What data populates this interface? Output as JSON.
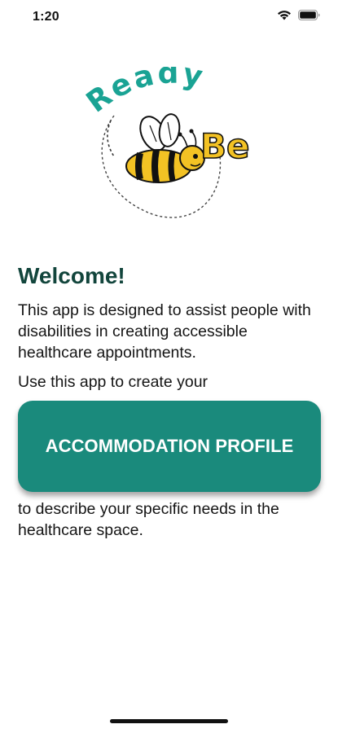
{
  "status_bar": {
    "time": "1:20",
    "icons": [
      "wifi-icon",
      "battery-icon"
    ]
  },
  "logo": {
    "word_top": "Ready",
    "word_right": "Be",
    "image": "bee-illustration",
    "colors": {
      "ready": "#1aa394",
      "be": "#f3c224",
      "bee_body": "#f3c224",
      "bee_stripes": "#111111"
    }
  },
  "welcome": {
    "title": "Welcome!",
    "description": "This app is designed to assist people with disabilities in creating accessible healthcare appointments.",
    "lead_in": "Use this app to create your",
    "button_label": "ACCOMMODATION PROFILE",
    "follow_up": "to describe your specific needs in the healthcare space."
  },
  "theme": {
    "accent": "#1a8a7c",
    "title_color": "#12453c"
  }
}
